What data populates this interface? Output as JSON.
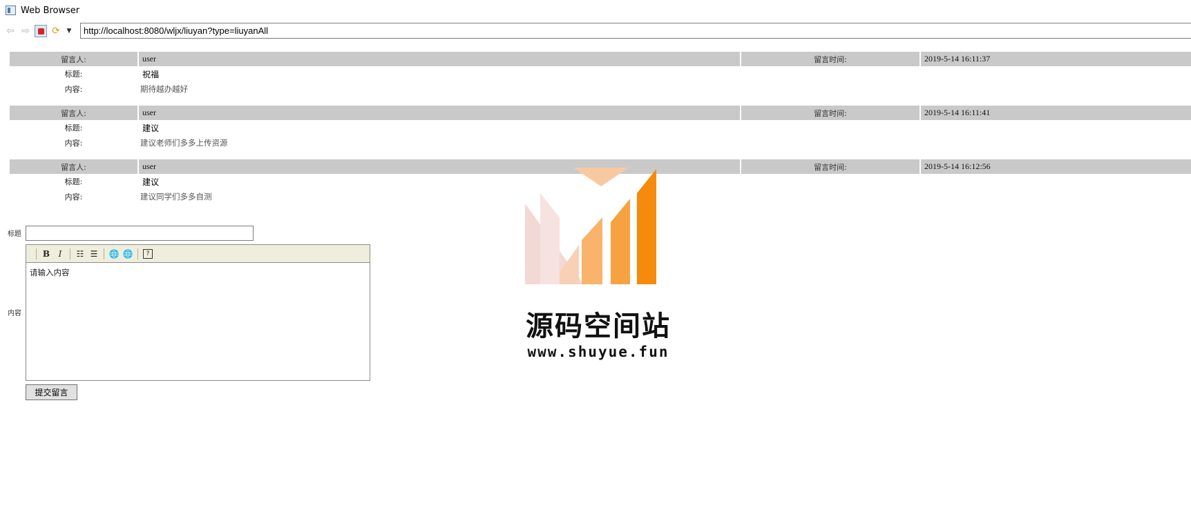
{
  "window": {
    "title": "Web Browser"
  },
  "toolbar": {
    "back_icon": "back-arrow-icon",
    "forward_icon": "forward-arrow-icon",
    "stop_icon": "stop-icon",
    "refresh_icon": "refresh-icon",
    "address": "http://localhost:8080/wljx/liuyan?type=liuyanAll"
  },
  "labels": {
    "author": "留言人:",
    "time": "留言时间:",
    "title": "标题:",
    "content": "内容:"
  },
  "messages": [
    {
      "author": "user",
      "time": "2019-5-14 16:11:37",
      "title": "祝福",
      "content": "期待越办越好"
    },
    {
      "author": "user",
      "time": "2019-5-14 16:11:41",
      "title": "建议",
      "content": "建议老师们多多上传资源"
    },
    {
      "author": "user",
      "time": "2019-5-14 16:12:56",
      "title": "建议",
      "content": "建议同学们多多自测"
    }
  ],
  "form": {
    "title_label": "标题",
    "title_value": "",
    "content_label": "内容",
    "editor_placeholder": "请输入内容",
    "submit_label": "提交留言"
  },
  "editor_toolbar": {
    "bold": "B",
    "italic": "I",
    "help": "?"
  },
  "watermark": {
    "name": "源码空间站",
    "url": "www.shuyue.fun"
  },
  "colors": {
    "header_gray": "#c9c9c9",
    "editor_toolbar_bg": "#efeedd",
    "watermark_orange": "#f7941d"
  }
}
